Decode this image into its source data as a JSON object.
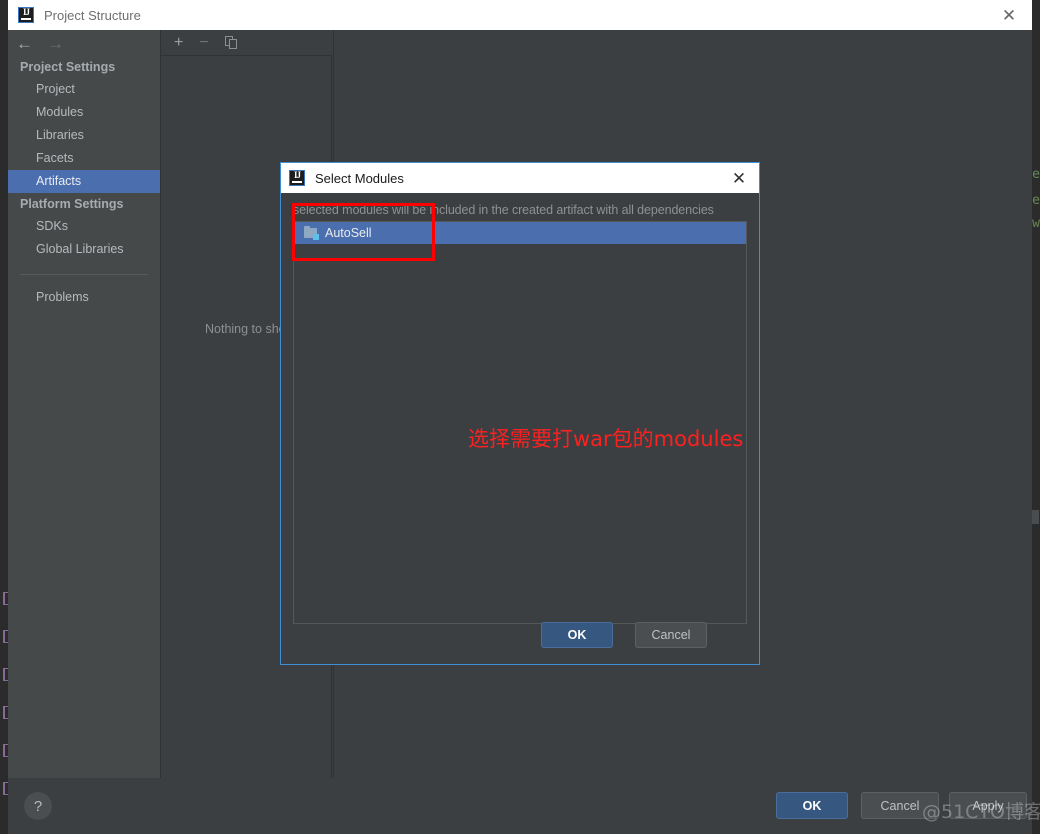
{
  "window": {
    "title": "Project Structure",
    "logo_icon": "intellij-idea-logo-icon",
    "close_icon": "close-icon"
  },
  "nav": {
    "back_icon": "arrow-left-icon",
    "forward_icon": "arrow-right-icon"
  },
  "sidebar": {
    "groups": [
      {
        "label": "Project Settings",
        "items": [
          {
            "label": "Project",
            "selected": false
          },
          {
            "label": "Modules",
            "selected": false
          },
          {
            "label": "Libraries",
            "selected": false
          },
          {
            "label": "Facets",
            "selected": false
          },
          {
            "label": "Artifacts",
            "selected": true
          }
        ]
      },
      {
        "label": "Platform Settings",
        "items": [
          {
            "label": "SDKs",
            "selected": false
          },
          {
            "label": "Global Libraries",
            "selected": false
          }
        ]
      }
    ],
    "extra": [
      {
        "label": "Problems",
        "selected": false
      }
    ]
  },
  "toolbar": {
    "add_icon": "plus-icon",
    "remove_icon": "minus-icon",
    "copy_icon": "copy-icon"
  },
  "detail": {
    "empty_text": "Nothing to show"
  },
  "footer": {
    "help_label": "?",
    "ok_label": "OK",
    "cancel_label": "Cancel",
    "apply_label": "Apply"
  },
  "dialog": {
    "title": "Select Modules",
    "logo_icon": "intellij-idea-logo-icon",
    "close_icon": "close-icon",
    "hint": "selected modules will be included in the created artifact with all dependencies",
    "modules": [
      {
        "label": "AutoSell",
        "selected": true,
        "icon": "module-folder-icon"
      }
    ],
    "ok_label": "OK",
    "cancel_label": "Cancel"
  },
  "annotations": {
    "callout_text": "选择需要打war包的modules",
    "callout_color": "#fd2020",
    "box_color": "#ff0000"
  },
  "watermark": {
    "text": "@51CTO博客"
  },
  "background": {
    "code_fragments": [
      "e",
      "e",
      "w"
    ]
  },
  "colors": {
    "window_bg": "#3c3f41",
    "sidebar_bg": "#45494a",
    "selection_blue": "#4b6eaf",
    "primary_button": "#365880",
    "dialog_border": "#3f8fd2",
    "titlebar_bg": "#ffffff",
    "editor_bg": "#2b2b2b"
  }
}
